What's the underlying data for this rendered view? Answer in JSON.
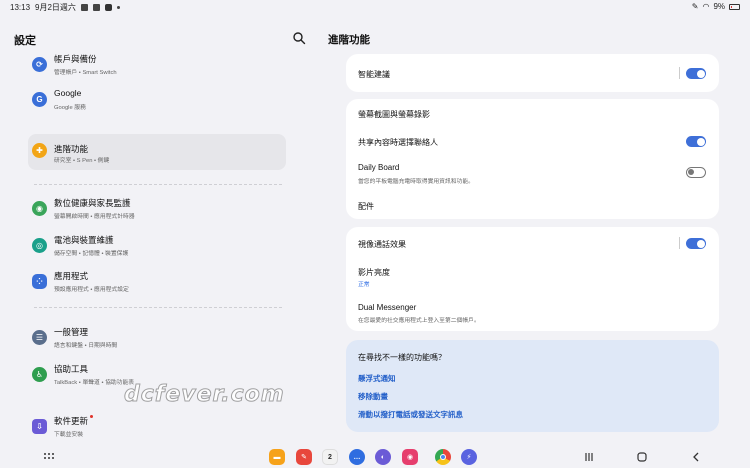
{
  "status_bar": {
    "time": "13:13",
    "date": "9月2日週六",
    "battery": "9%"
  },
  "left_pane": {
    "title": "設定",
    "items": [
      {
        "title": "帳戶與備份",
        "subtitle": "管理帳戶 • Smart Switch",
        "icon": "sync-icon",
        "color": "#3a6fd8"
      },
      {
        "title": "Google",
        "subtitle": "Google 服務",
        "icon": "google-icon",
        "color": "#3a6fd8"
      },
      {
        "title": "進階功能",
        "subtitle": "研究室 • S Pen • 側鍵",
        "icon": "plus-gear-icon",
        "color": "#f2a516"
      },
      {
        "title": "數位健康與家長監護",
        "subtitle": "螢幕開啟時間 • 應用程式計時器",
        "icon": "wellbeing-icon",
        "color": "#3aa55a"
      },
      {
        "title": "電池與裝置維護",
        "subtitle": "儲存空間 • 記憶體 • 裝置保護",
        "icon": "device-care-icon",
        "color": "#1aa08a"
      },
      {
        "title": "應用程式",
        "subtitle": "預設應用程式 • 應用程式設定",
        "icon": "apps-icon",
        "color": "#3a6fd8"
      },
      {
        "title": "一般管理",
        "subtitle": "語言和鍵盤 • 日期與時間",
        "icon": "general-management-icon",
        "color": "#5a6e8c"
      },
      {
        "title": "協助工具",
        "subtitle": "TalkBack • 單聲道 • 協助功能表",
        "icon": "accessibility-icon",
        "color": "#2f9e4f"
      },
      {
        "title": "軟件更新",
        "subtitle": "下載並安裝",
        "icon": "software-update-icon",
        "color": "#6b5bd6"
      }
    ]
  },
  "right_pane": {
    "title": "進階功能",
    "card1": {
      "row1": {
        "title": "智能建議",
        "toggle": "on"
      }
    },
    "card2": {
      "row1": {
        "title": "螢幕截圖與螢幕錄影"
      },
      "row2": {
        "title": "共享內容時選擇聯絡人",
        "toggle": "on"
      },
      "row3": {
        "title": "Daily Board",
        "subtitle": "當您的平板電腦充電時取得實用資訊和功能。",
        "toggle": "off"
      },
      "row4": {
        "title": "配件"
      }
    },
    "card3": {
      "row1": {
        "title": "視像通話效果",
        "toggle": "on"
      },
      "row2": {
        "title": "影片亮度",
        "subtitle": "正常"
      },
      "row3": {
        "title": "Dual Messenger",
        "subtitle": "在您最愛的社交應用程式上登入至第二個帳戶。"
      }
    },
    "suggest_card": {
      "heading": "在尋找不一樣的功能嗎？",
      "links": [
        "懸浮式通知",
        "移除動畫",
        "滑動以撥打電話或發送文字訊息"
      ]
    }
  },
  "watermark": "dcfever.com",
  "dock": {
    "apps": [
      {
        "name": "my-files-icon",
        "color": "#f6a21a"
      },
      {
        "name": "notes-icon",
        "color": "#e8473c"
      },
      {
        "name": "calendar-icon",
        "color": "#f2f2f2",
        "label": "2"
      },
      {
        "name": "messages-icon",
        "color": "#2f6de0"
      },
      {
        "name": "internet-icon",
        "color": "#6b5bd6"
      },
      {
        "name": "camera-icon",
        "color": "#e63e6d"
      },
      {
        "name": "chrome-icon",
        "color": "#4a88f0"
      },
      {
        "name": "messenger-icon",
        "color": "#5a63e0"
      }
    ]
  }
}
